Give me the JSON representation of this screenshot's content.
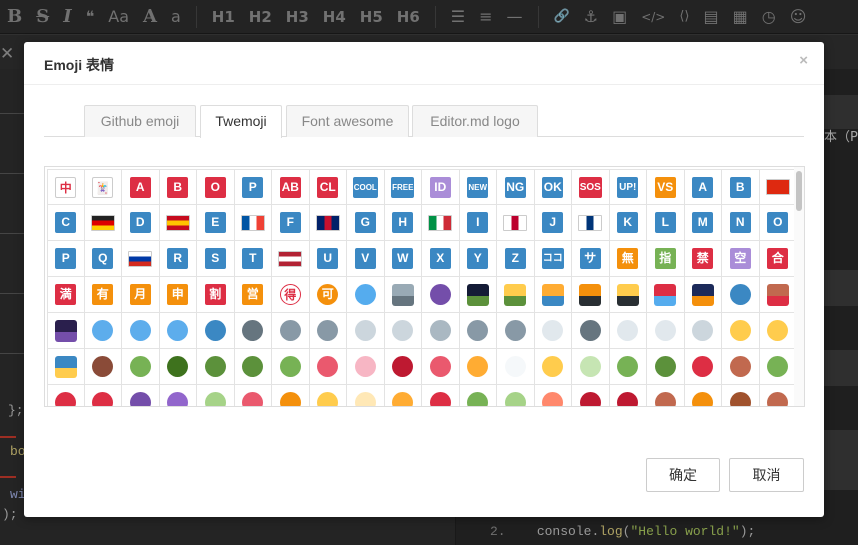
{
  "toolbar": {
    "bold": "B",
    "strike": "S",
    "italic": "I",
    "quote": "❝",
    "case_upper": "Aa",
    "case_a": "A",
    "case_lower": "a",
    "h1": "H1",
    "h2": "H2",
    "h3": "H3",
    "h4": "H4",
    "h5": "H5",
    "h6": "H6",
    "list_ul": "☰",
    "list_ol": "≡",
    "hr": "—",
    "link": "🔗",
    "anchor": "⚓",
    "image": "▣",
    "code": "</>",
    "code_block": "⟨⟩",
    "preformatted": "▤",
    "table": "▦",
    "datetime": "◷",
    "emoji": "☺"
  },
  "subbar": {
    "close": "✕"
  },
  "editor": {
    "line_close": "};",
    "line_bo": "bo",
    "line_wi": "wi",
    "line_end": ");",
    "right_text": "本（Pr",
    "code_linenum": "2.",
    "code_indent": "    ",
    "code_obj": "console",
    "code_dot": ".",
    "code_fn": "log",
    "code_open": "(",
    "code_str": "\"Hello world!\"",
    "code_close": ");"
  },
  "modal": {
    "title": "Emoji 表情",
    "close": "×",
    "tabs": [
      "Github emoji",
      "Twemoji",
      "Font awesome",
      "Editor.md logo"
    ],
    "active_tab": "Twemoji",
    "ok_button": "确定",
    "cancel_button": "取消"
  },
  "colors": {
    "accent_blue": "#3b88c3",
    "accent_red": "#dd2e44",
    "accent_orange": "#f4900c",
    "accent_green": "#77b255",
    "accent_purple": "#aa8dd8"
  },
  "emoji_rows": [
    [
      {
        "name": "mahjong-red-dragon",
        "t": "中",
        "bg": "#fff",
        "fg": "#dd2e44",
        "border": "#ccc"
      },
      {
        "name": "joker",
        "t": "🃏",
        "bg": "#fff",
        "fg": "#553788",
        "border": "#ccc"
      },
      {
        "name": "letter-a",
        "t": "A",
        "bg": "#dd2e44"
      },
      {
        "name": "letter-b",
        "t": "B",
        "bg": "#dd2e44"
      },
      {
        "name": "letter-o",
        "t": "O",
        "bg": "#dd2e44"
      },
      {
        "name": "letter-p",
        "t": "P",
        "bg": "#3b88c3"
      },
      {
        "name": "ab",
        "t": "AB",
        "bg": "#dd2e44"
      },
      {
        "name": "cl",
        "t": "CL",
        "bg": "#dd2e44"
      },
      {
        "name": "cool",
        "t": "COOL",
        "bg": "#3b88c3",
        "size": "sm"
      },
      {
        "name": "free",
        "t": "FREE",
        "bg": "#3b88c3",
        "size": "sm"
      },
      {
        "name": "id",
        "t": "ID",
        "bg": "#aa8dd8"
      },
      {
        "name": "new",
        "t": "NEW",
        "bg": "#3b88c3",
        "size": "sm"
      },
      {
        "name": "ng",
        "t": "NG",
        "bg": "#3b88c3"
      },
      {
        "name": "ok",
        "t": "OK",
        "bg": "#3b88c3"
      },
      {
        "name": "sos",
        "t": "SOS",
        "bg": "#dd2e44",
        "size": "md"
      },
      {
        "name": "up",
        "t": "UP!",
        "bg": "#3b88c3",
        "size": "md"
      },
      {
        "name": "vs",
        "t": "VS",
        "bg": "#f4900c"
      },
      {
        "name": "letter-a2",
        "t": "A",
        "bg": "#3b88c3"
      },
      {
        "name": "letter-b2",
        "t": "B",
        "bg": "#3b88c3"
      },
      {
        "name": "flag-cn",
        "kind": "flag",
        "c1": "#de2910",
        "c2": "#de2910",
        "c3": "#de2910"
      }
    ],
    [
      {
        "name": "letter-c",
        "t": "C",
        "bg": "#3b88c3"
      },
      {
        "name": "flag-de",
        "kind": "flag",
        "c1": "#222",
        "c2": "#dd0000",
        "c3": "#ffce00",
        "dir": "h"
      },
      {
        "name": "letter-d",
        "t": "D",
        "bg": "#3b88c3"
      },
      {
        "name": "flag-es",
        "kind": "flag",
        "c1": "#c60b1e",
        "c2": "#ffc400",
        "c3": "#c60b1e",
        "dir": "h"
      },
      {
        "name": "letter-e",
        "t": "E",
        "bg": "#3b88c3"
      },
      {
        "name": "flag-fr",
        "kind": "flag",
        "c1": "#0055a4",
        "c2": "#fff",
        "c3": "#ef4135",
        "dir": "v"
      },
      {
        "name": "letter-f",
        "t": "F",
        "bg": "#3b88c3"
      },
      {
        "name": "flag-gb",
        "kind": "flag",
        "c1": "#012169",
        "c2": "#c8102e",
        "c3": "#012169",
        "dir": "v"
      },
      {
        "name": "letter-g",
        "t": "G",
        "bg": "#3b88c3"
      },
      {
        "name": "letter-h",
        "t": "H",
        "bg": "#3b88c3"
      },
      {
        "name": "flag-it",
        "kind": "flag",
        "c1": "#009246",
        "c2": "#fff",
        "c3": "#ce2b37",
        "dir": "v"
      },
      {
        "name": "letter-i",
        "t": "I",
        "bg": "#3b88c3"
      },
      {
        "name": "flag-jp",
        "kind": "flag",
        "c1": "#fff",
        "c2": "#bc002d",
        "c3": "#fff",
        "dir": "v"
      },
      {
        "name": "letter-j",
        "t": "J",
        "bg": "#3b88c3"
      },
      {
        "name": "flag-kr",
        "kind": "flag",
        "c1": "#fff",
        "c2": "#003478",
        "c3": "#fff",
        "dir": "v"
      },
      {
        "name": "letter-k",
        "t": "K",
        "bg": "#3b88c3"
      },
      {
        "name": "letter-l",
        "t": "L",
        "bg": "#3b88c3"
      },
      {
        "name": "letter-m",
        "t": "M",
        "bg": "#3b88c3"
      },
      {
        "name": "letter-n",
        "t": "N",
        "bg": "#3b88c3"
      },
      {
        "name": "letter-o2",
        "t": "O",
        "bg": "#3b88c3"
      }
    ],
    [
      {
        "name": "letter-p2",
        "t": "P",
        "bg": "#3b88c3"
      },
      {
        "name": "letter-q",
        "t": "Q",
        "bg": "#3b88c3"
      },
      {
        "name": "flag-ru",
        "kind": "flag",
        "c1": "#fff",
        "c2": "#0039a6",
        "c3": "#d52b1e",
        "dir": "h"
      },
      {
        "name": "letter-r",
        "t": "R",
        "bg": "#3b88c3"
      },
      {
        "name": "letter-s",
        "t": "S",
        "bg": "#3b88c3"
      },
      {
        "name": "letter-t",
        "t": "T",
        "bg": "#3b88c3"
      },
      {
        "name": "flag-us",
        "kind": "flag",
        "c1": "#b22234",
        "c2": "#fff",
        "c3": "#b22234",
        "dir": "h"
      },
      {
        "name": "letter-u",
        "t": "U",
        "bg": "#3b88c3"
      },
      {
        "name": "letter-v",
        "t": "V",
        "bg": "#3b88c3"
      },
      {
        "name": "letter-w",
        "t": "W",
        "bg": "#3b88c3"
      },
      {
        "name": "letter-x",
        "t": "X",
        "bg": "#3b88c3"
      },
      {
        "name": "letter-y",
        "t": "Y",
        "bg": "#3b88c3"
      },
      {
        "name": "letter-z",
        "t": "Z",
        "bg": "#3b88c3"
      },
      {
        "name": "koko",
        "t": "ココ",
        "bg": "#3b88c3",
        "size": "md"
      },
      {
        "name": "sa",
        "t": "サ",
        "bg": "#3b88c3"
      },
      {
        "name": "mu",
        "t": "無",
        "bg": "#f4900c"
      },
      {
        "name": "yubi",
        "t": "指",
        "bg": "#77b255"
      },
      {
        "name": "kin",
        "t": "禁",
        "bg": "#dd2e44"
      },
      {
        "name": "kuu",
        "t": "空",
        "bg": "#aa8dd8"
      },
      {
        "name": "gou",
        "t": "合",
        "bg": "#dd2e44"
      }
    ],
    [
      {
        "name": "man",
        "t": "満",
        "bg": "#dd2e44"
      },
      {
        "name": "yuu",
        "t": "有",
        "bg": "#f4900c"
      },
      {
        "name": "getsu",
        "t": "月",
        "bg": "#f4900c"
      },
      {
        "name": "shin",
        "t": "申",
        "bg": "#f4900c"
      },
      {
        "name": "wari",
        "t": "割",
        "bg": "#dd2e44"
      },
      {
        "name": "ei",
        "t": "営",
        "bg": "#f4900c"
      },
      {
        "name": "toku",
        "t": "得",
        "bg": "#fff",
        "fg": "#dd2e44",
        "circle": true,
        "border": "#dd2e44"
      },
      {
        "name": "ka",
        "t": "可",
        "bg": "#f4900c",
        "circle": true
      },
      {
        "name": "cyclone",
        "kind": "dot",
        "c1": "#55acee"
      },
      {
        "name": "foggy",
        "kind": "pic",
        "c1": "#99aab5",
        "c2": "#66757f"
      },
      {
        "name": "closed-umbrella",
        "kind": "dot",
        "c1": "#744eaa"
      },
      {
        "name": "night-with-stars",
        "kind": "pic",
        "c1": "#141b36",
        "c2": "#5c913b"
      },
      {
        "name": "sunrise-over-mountains",
        "kind": "pic",
        "c1": "#ffcc4d",
        "c2": "#5c913b"
      },
      {
        "name": "sunrise",
        "kind": "pic",
        "c1": "#ffac33",
        "c2": "#3b88c3"
      },
      {
        "name": "city-sunset",
        "kind": "pic",
        "c1": "#f4900c",
        "c2": "#292f33"
      },
      {
        "name": "city-sunrise",
        "kind": "pic",
        "c1": "#ffcc4d",
        "c2": "#292f33"
      },
      {
        "name": "rainbow",
        "kind": "pic",
        "c1": "#dd2e44",
        "c2": "#55acee"
      },
      {
        "name": "bridge-at-night",
        "kind": "pic",
        "c1": "#1c2a5a",
        "c2": "#f4900c"
      },
      {
        "name": "ocean",
        "kind": "dot",
        "c1": "#3b88c3"
      },
      {
        "name": "volcano",
        "kind": "pic",
        "c1": "#c1694f",
        "c2": "#dd2e44"
      }
    ],
    [
      {
        "name": "milky-way",
        "kind": "pic",
        "c1": "#2a1f4d",
        "c2": "#744eaa"
      },
      {
        "name": "earth-africa",
        "kind": "dot",
        "c1": "#5dadec"
      },
      {
        "name": "earth-americas",
        "kind": "dot",
        "c1": "#5dadec"
      },
      {
        "name": "earth-asia",
        "kind": "dot",
        "c1": "#5dadec"
      },
      {
        "name": "globe-with-meridians",
        "kind": "dot",
        "c1": "#3b88c3"
      },
      {
        "name": "new-moon",
        "kind": "dot",
        "c1": "#66757f"
      },
      {
        "name": "waxing-crescent-moon",
        "kind": "dot",
        "c1": "#8899a6"
      },
      {
        "name": "first-quarter-moon",
        "kind": "dot",
        "c1": "#8899a6"
      },
      {
        "name": "waxing-gibbous-moon",
        "kind": "dot",
        "c1": "#ccd6dd"
      },
      {
        "name": "full-moon",
        "kind": "dot",
        "c1": "#ccd6dd"
      },
      {
        "name": "waning-gibbous-moon",
        "kind": "dot",
        "c1": "#aab8c2"
      },
      {
        "name": "last-quarter-moon",
        "kind": "dot",
        "c1": "#8899a6"
      },
      {
        "name": "waning-crescent-moon",
        "kind": "dot",
        "c1": "#8899a6"
      },
      {
        "name": "crescent-moon",
        "kind": "dot",
        "c1": "#e1e8ed"
      },
      {
        "name": "new-moon-face",
        "kind": "dot",
        "c1": "#66757f"
      },
      {
        "name": "first-quarter-moon-face",
        "kind": "dot",
        "c1": "#e1e8ed"
      },
      {
        "name": "last-quarter-moon-face",
        "kind": "dot",
        "c1": "#e1e8ed"
      },
      {
        "name": "full-moon-face",
        "kind": "dot",
        "c1": "#ccd6dd"
      },
      {
        "name": "sun-with-face",
        "kind": "dot",
        "c1": "#ffcc4d"
      },
      {
        "name": "star2",
        "kind": "dot",
        "c1": "#ffcc4d"
      }
    ],
    [
      {
        "name": "stars",
        "kind": "pic",
        "c1": "#3b88c3",
        "c2": "#ffcc4d"
      },
      {
        "name": "chestnut",
        "kind": "dot",
        "c1": "#8a4b38"
      },
      {
        "name": "seedling",
        "kind": "dot",
        "c1": "#77b255"
      },
      {
        "name": "evergreen-tree",
        "kind": "dot",
        "c1": "#3e721d"
      },
      {
        "name": "deciduous-tree",
        "kind": "dot",
        "c1": "#5c913b"
      },
      {
        "name": "palm-tree",
        "kind": "dot",
        "c1": "#5c913b"
      },
      {
        "name": "cactus",
        "kind": "dot",
        "c1": "#77b255"
      },
      {
        "name": "tulip",
        "kind": "dot",
        "c1": "#ea596e"
      },
      {
        "name": "cherry-blossom",
        "kind": "dot",
        "c1": "#f7b6c4"
      },
      {
        "name": "rose",
        "kind": "dot",
        "c1": "#be1931"
      },
      {
        "name": "hibiscus",
        "kind": "dot",
        "c1": "#ea596e"
      },
      {
        "name": "sunflower",
        "kind": "dot",
        "c1": "#ffac33"
      },
      {
        "name": "blossom",
        "kind": "dot",
        "c1": "#f5f8fa"
      },
      {
        "name": "corn",
        "kind": "dot",
        "c1": "#ffcc4d"
      },
      {
        "name": "ear-of-rice",
        "kind": "dot",
        "c1": "#c6e5b3"
      },
      {
        "name": "herb",
        "kind": "dot",
        "c1": "#77b255"
      },
      {
        "name": "four-leaf-clover",
        "kind": "dot",
        "c1": "#5c913b"
      },
      {
        "name": "maple-leaf",
        "kind": "dot",
        "c1": "#dd2e44"
      },
      {
        "name": "fallen-leaf",
        "kind": "dot",
        "c1": "#c1694f"
      },
      {
        "name": "leaves",
        "kind": "dot",
        "c1": "#77b255"
      }
    ],
    [
      {
        "name": "mushroom",
        "kind": "dot",
        "c1": "#dd2e44"
      },
      {
        "name": "tomato",
        "kind": "dot",
        "c1": "#dd2e44"
      },
      {
        "name": "eggplant",
        "kind": "dot",
        "c1": "#744eaa"
      },
      {
        "name": "grapes",
        "kind": "dot",
        "c1": "#9266cc"
      },
      {
        "name": "melon",
        "kind": "dot",
        "c1": "#a6d388"
      },
      {
        "name": "watermelon",
        "kind": "dot",
        "c1": "#ea596e"
      },
      {
        "name": "tangerine",
        "kind": "dot",
        "c1": "#f4900c"
      },
      {
        "name": "lemon",
        "kind": "dot",
        "c1": "#ffcc4d"
      },
      {
        "name": "banana",
        "kind": "dot",
        "c1": "#ffe8b6"
      },
      {
        "name": "pineapple",
        "kind": "dot",
        "c1": "#ffac33"
      },
      {
        "name": "apple",
        "kind": "dot",
        "c1": "#dd2e44"
      },
      {
        "name": "green-apple",
        "kind": "dot",
        "c1": "#77b255"
      },
      {
        "name": "pear",
        "kind": "dot",
        "c1": "#a6d388"
      },
      {
        "name": "peach",
        "kind": "dot",
        "c1": "#ff886c"
      },
      {
        "name": "cherries",
        "kind": "dot",
        "c1": "#be1931"
      },
      {
        "name": "strawberry",
        "kind": "dot",
        "c1": "#be1931"
      },
      {
        "name": "hamburger",
        "kind": "dot",
        "c1": "#c1694f"
      },
      {
        "name": "pizza",
        "kind": "dot",
        "c1": "#f4900c"
      },
      {
        "name": "meat-on-bone",
        "kind": "dot",
        "c1": "#a0522d"
      },
      {
        "name": "poultry-leg",
        "kind": "dot",
        "c1": "#c1694f"
      }
    ]
  ]
}
